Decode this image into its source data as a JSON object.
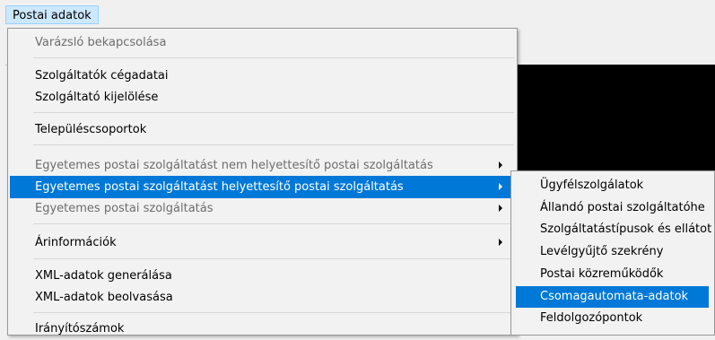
{
  "menubar": {
    "title": "Postai adatok"
  },
  "background": {
    "colon": ":"
  },
  "menu": {
    "items": [
      {
        "label": "Varázsló bekapcsolása",
        "disabled": true
      },
      {
        "label": "Szolgáltatók cégadatai"
      },
      {
        "label": "Szolgáltató kijelölése"
      },
      {
        "label": "Településcsoportok"
      },
      {
        "label": "Egyetemes postai szolgáltatást nem helyettesítő postai szolgáltatás",
        "disabled": true,
        "submenu": true
      },
      {
        "label": "Egyetemes postai szolgáltatást helyettesítő postai szolgáltatás",
        "highlighted": true,
        "submenu": true
      },
      {
        "label": "Egyetemes postai szolgáltatás",
        "disabled": true,
        "submenu": true
      },
      {
        "label": "Árinformációk",
        "submenu": true
      },
      {
        "label": "XML-adatok generálása"
      },
      {
        "label": "XML-adatok beolvasása"
      },
      {
        "label": "Irányítószámok"
      }
    ]
  },
  "submenu": {
    "items": [
      {
        "label": "Ügyfélszolgálatok"
      },
      {
        "label": "Állandó postai szolgáltatóhe"
      },
      {
        "label": "Szolgáltatástípusok és ellátot"
      },
      {
        "label": "Levélgyűjtő szekrény"
      },
      {
        "label": "Postai közreműködők"
      },
      {
        "label": "Csomagautomata-adatok",
        "highlighted": true
      },
      {
        "label": "Feldolgozópontok"
      }
    ]
  }
}
